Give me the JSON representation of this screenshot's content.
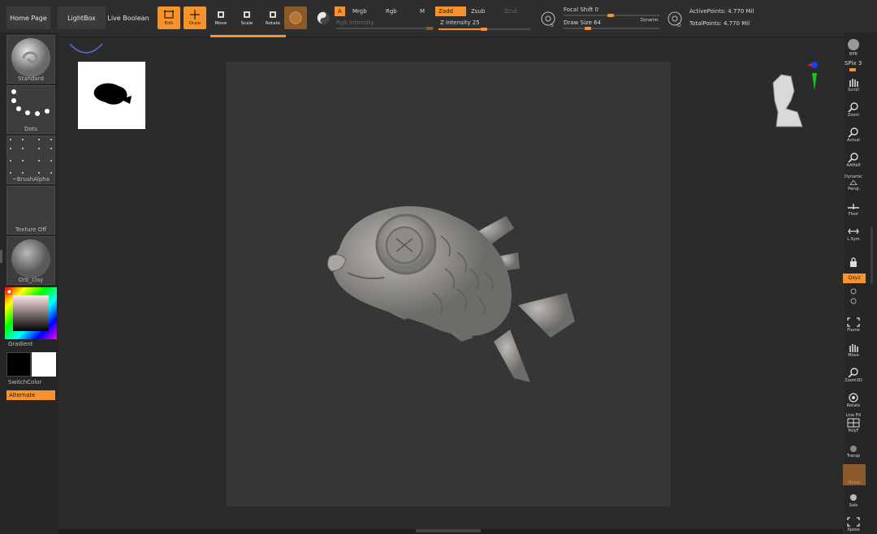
{
  "nav": {
    "home": "Home Page",
    "lightbox": "LightBox",
    "live_boolean": "Live Boolean"
  },
  "tools": {
    "edit": "Edit",
    "draw": "Draw",
    "move": "Move",
    "scale": "Scale",
    "rotate": "Rotate"
  },
  "color_mode": {
    "a": "A",
    "mrgb": "Mrgb",
    "rgb": "Rgb",
    "m": "M",
    "rgb_intensity": "Rgb Intensity"
  },
  "z_mode": {
    "zadd": "Zadd",
    "zsub": "Zsub",
    "zcut": "Zcut",
    "z_intensity": "Z Intensity 25"
  },
  "brush": {
    "focal_shift": "Focal Shift 0",
    "draw_size": "Draw Size 64",
    "dynamic": "Dynamic"
  },
  "stats": {
    "active_points": "ActivePoints: 4.770 Mil",
    "total_points": "TotalPoints: 4.770 Mil"
  },
  "left_shelf": {
    "brush": "Standard",
    "stroke": "Dots",
    "alpha": "~BrushAlpha",
    "texture": "Texture Off",
    "material": "Orb_clay",
    "gradient": "Gradient",
    "switch_color": "SwitchColor",
    "alternate": "Alternate"
  },
  "right_shelf": {
    "bpr": "BPR",
    "spix": "SPix 3",
    "scroll": "Scroll",
    "zoom": "Zoom",
    "actual": "Actual",
    "aahalf": "AAHalf",
    "dynamic": "Dynamic",
    "persp": "Persp",
    "floor": "Floor",
    "lsym": "L.Sym",
    "lock": "",
    "xyz": "Qxyz",
    "frame": "Frame",
    "move": "Move",
    "zoom3d": "Zoom3D",
    "rotate": "Rotate",
    "line_fill": "Line Fill",
    "polyf": "PolyF",
    "transp": "Transp",
    "ghost": "Ghost",
    "solo": "Solo",
    "xpose": "Xpose"
  },
  "colors": {
    "accent": "#f7932f",
    "panel": "#262626",
    "canvas": "#363636",
    "primary_color": "#000000",
    "secondary_color": "#ffffff"
  }
}
